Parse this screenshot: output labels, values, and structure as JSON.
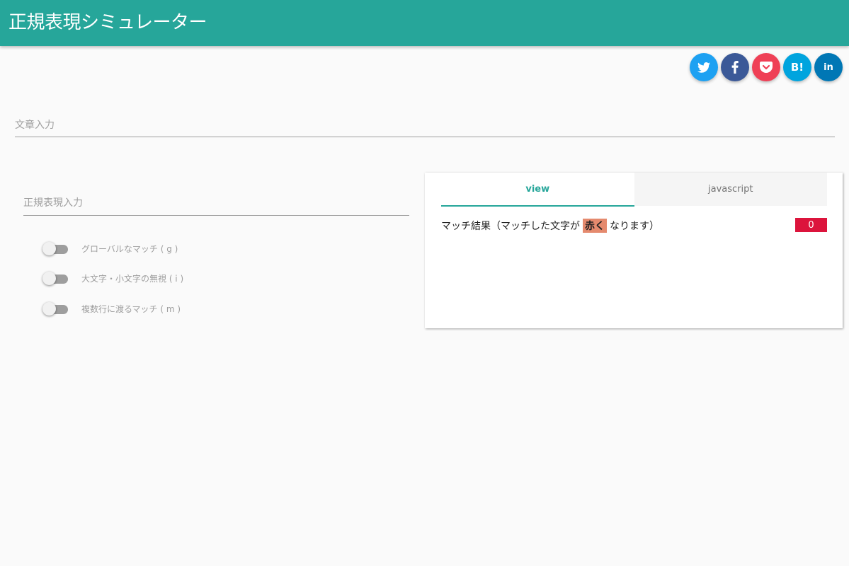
{
  "app": {
    "title": "正規表現シミュレーター",
    "accent_color": "#26a69a"
  },
  "share": [
    {
      "name": "twitter",
      "icon": "twitter-icon",
      "color": "#1da1f2"
    },
    {
      "name": "facebook",
      "icon": "facebook-icon",
      "color": "#3b5998"
    },
    {
      "name": "pocket",
      "icon": "pocket-icon",
      "color": "#ef4056",
      "glyph": ""
    },
    {
      "name": "hatena-bookmark",
      "icon": "hatena-icon",
      "color": "#00a4de",
      "glyph": "B!"
    },
    {
      "name": "linkedin",
      "icon": "linkedin-icon",
      "color": "#0077b5",
      "glyph": "in"
    }
  ],
  "text_input": {
    "placeholder": "文章入力",
    "value": ""
  },
  "regex_input": {
    "placeholder": "正規表現入力",
    "value": ""
  },
  "flags": [
    {
      "label": "グローバルなマッチ ( g )",
      "on": false
    },
    {
      "label": "大文字・小文字の無視 ( i )",
      "on": false
    },
    {
      "label": "複数行に渡るマッチ ( m )",
      "on": false
    }
  ],
  "result": {
    "tabs": [
      {
        "label": "view",
        "active": true
      },
      {
        "label": "javascript",
        "active": false
      }
    ],
    "prefix": "マッチ結果（マッチした文字が",
    "highlight": "赤く",
    "suffix": "なります）",
    "highlight_color": "#e58a6e",
    "count": "0",
    "count_color": "#dc143c"
  }
}
